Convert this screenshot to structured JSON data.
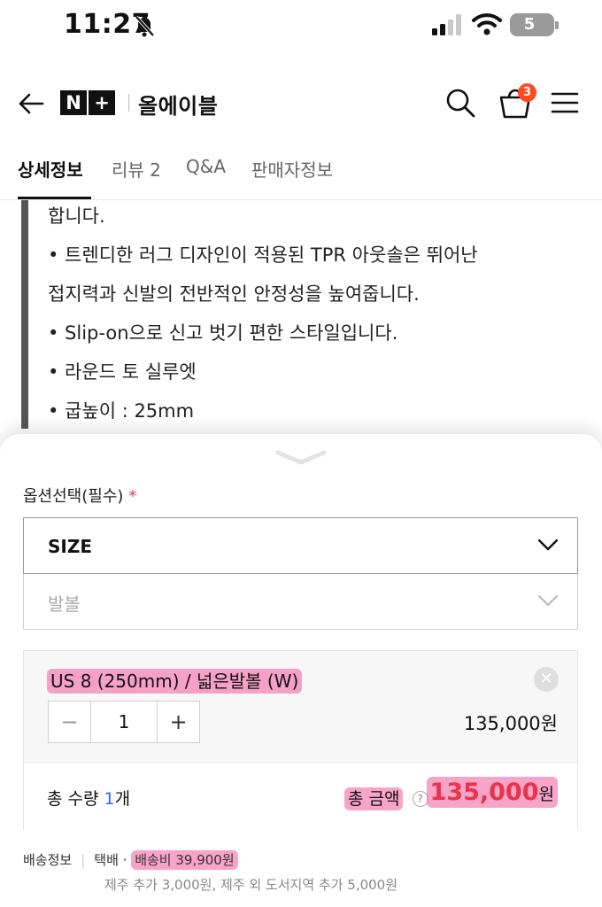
{
  "status_bar": {
    "time": "11:27",
    "battery": "5"
  },
  "header": {
    "logo_n": "N",
    "logo_plus": "+",
    "store_name": "올에이블",
    "cart_count": "3"
  },
  "tabs": [
    {
      "label": "상세정보"
    },
    {
      "label": "리뷰 2"
    },
    {
      "label": "Q&A"
    },
    {
      "label": "판매자정보"
    }
  ],
  "description": [
    "합니다.",
    "• 트렌디한 러그 디자인이 적용된 TPR 아웃솔은 뛰어난",
    "접지력과 신발의 전반적인 안정성을 높여줍니다.",
    "• Slip-on으로 신고 벗기 편한 스타일입니다.",
    "• 라운드 토 실루엣",
    "• 굽높이 : 25mm"
  ],
  "options": {
    "label": "옵션선택(필수)",
    "required_mark": "*",
    "size_select": "SIZE",
    "foot_select": "발볼"
  },
  "selected": {
    "name": "US 8 (250mm) / 넓은발볼 (W)",
    "quantity": "1",
    "decrement": "−",
    "increment": "+",
    "price": "135,000원"
  },
  "summary": {
    "qty_label": "총 수량 ",
    "qty_value": "1",
    "qty_unit": "개",
    "total_label": "총 금액",
    "total_value": "135,000",
    "total_unit": "원"
  },
  "shipping": {
    "label": "배송정보",
    "method": "택배 ·",
    "fee": "배송비 39,900원",
    "extra": "제주 추가 3,000원, 제주 외 도서지역 추가 5,000원"
  },
  "colors": {
    "accent_red": "#e8334a",
    "badge": "#ff4b1f",
    "highlight": "#f46ca7",
    "qty_blue": "#2b6be8"
  }
}
